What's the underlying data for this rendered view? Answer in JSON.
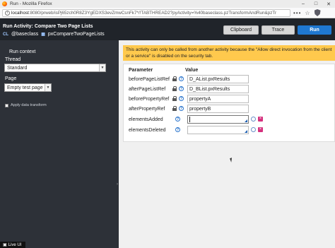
{
  "window": {
    "title": "Run - Mozilla Firefox",
    "controls": [
      "minimize-icon",
      "maximize-icon",
      "close-icon"
    ]
  },
  "browser": {
    "url_host": "localhost",
    "url_rest": ":8080/prweb/isPj65zch0R8Z3YgEDXS3evZmwCsnFk7*/!TABTHREAD2?pyActivity=%40baseclass.pzTransformAndRun&pzTr",
    "ellipsis": "•••"
  },
  "header": {
    "title": "Run  Activity:  Compare Two Page Lists",
    "class_tag": "CL",
    "class_name": "@baseclass",
    "activity_name": "pxCompareTwoPageLists",
    "buttons": {
      "clipboard": "Clipboard",
      "trace": "Trace",
      "run": "Run"
    }
  },
  "sidebar": {
    "section_title": "Run context",
    "thread_label": "Thread",
    "thread_value": "Standard",
    "page_label": "Page",
    "page_value": "Empty test page",
    "apply_label": "Apply data transform",
    "apply_checked": false
  },
  "warning": "This activity can only be called from another activity because the \"Allow direct invocation from the client or a service\" is disabled on the security tab.",
  "params": {
    "col_parameter": "Parameter",
    "col_value": "Value",
    "rows": [
      {
        "name": "beforePageListRef",
        "value": "D_AList.pxResults",
        "locked": true
      },
      {
        "name": "afterPageListRef",
        "value": "D_BList.pxResults",
        "locked": true
      },
      {
        "name": "beforePropertyRef",
        "value": "propertyA",
        "locked": true
      },
      {
        "name": "afterPropertyRef",
        "value": "propertyB",
        "locked": true
      },
      {
        "name": "elementsAdded",
        "value": "",
        "locked": false
      },
      {
        "name": "elementsDeleted",
        "value": "",
        "locked": false
      }
    ]
  },
  "status": {
    "live_ui": "Live UI"
  },
  "colors": {
    "header_bg": "#20242a",
    "panel_bg": "#2d3138",
    "run_button": "#1f78d1",
    "warning_bg": "#ffc94d"
  }
}
